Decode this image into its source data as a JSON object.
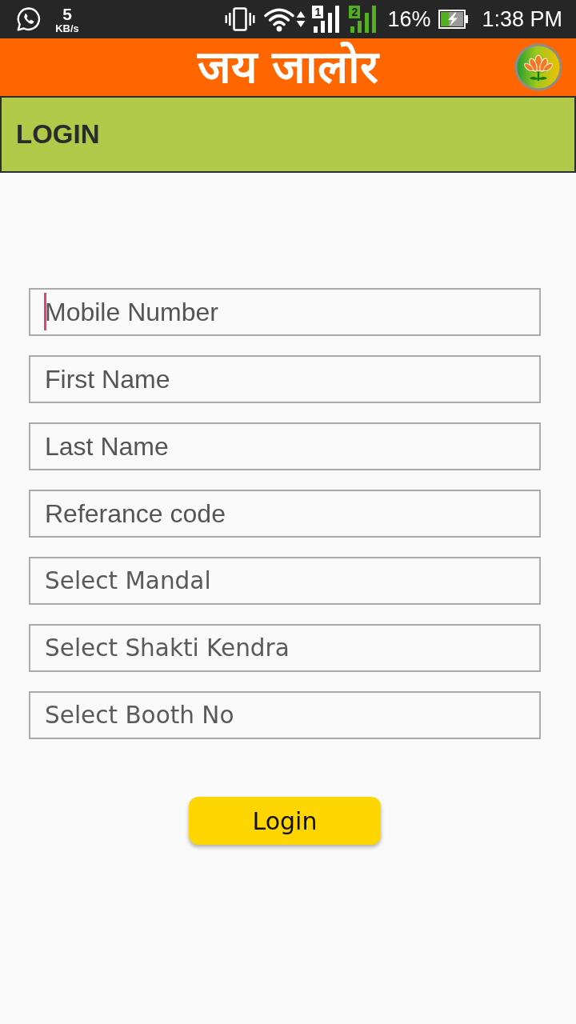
{
  "status_bar": {
    "network_speed": {
      "value": "5",
      "unit": "KB/s"
    },
    "sim_slots": [
      {
        "label": "1",
        "color": "#ffffff"
      },
      {
        "label": "2",
        "color": "#52b020"
      }
    ],
    "battery": "16%",
    "time": "1:38 PM"
  },
  "app_bar": {
    "title": "जय जालोर"
  },
  "section_header": {
    "title": "LOGIN"
  },
  "fields": [
    {
      "kind": "text",
      "placeholder": "Mobile Number",
      "focused": true
    },
    {
      "kind": "text",
      "placeholder": "First Name",
      "focused": false
    },
    {
      "kind": "text",
      "placeholder": "Last Name",
      "focused": false
    },
    {
      "kind": "text",
      "placeholder": "Referance code",
      "focused": false
    },
    {
      "kind": "select",
      "value": "Select Mandal"
    },
    {
      "kind": "select",
      "value": "Select Shakti Kendra"
    },
    {
      "kind": "select",
      "value": "Select Booth No"
    }
  ],
  "login_button": {
    "label": "Login"
  }
}
